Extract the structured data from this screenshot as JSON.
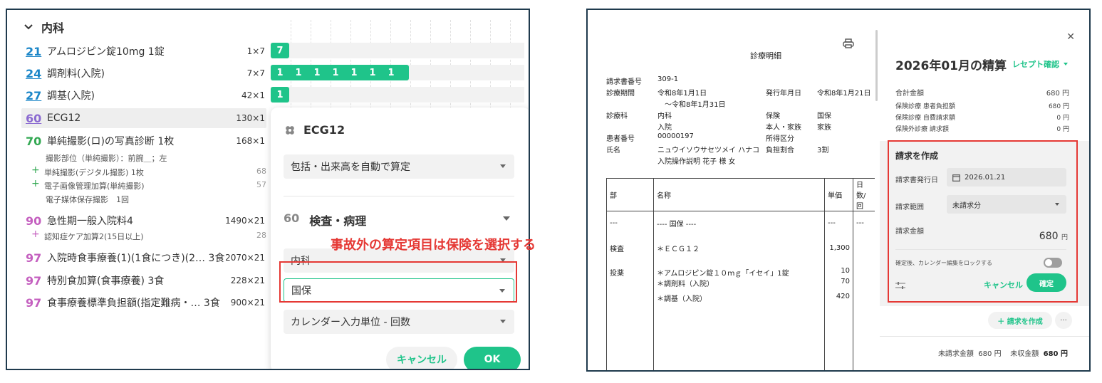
{
  "left": {
    "section_title": "内科",
    "items": [
      {
        "code": "21",
        "name": "アムロジピン錠10mg 1錠",
        "qty": "1×7",
        "style": "blue"
      },
      {
        "code": "24",
        "name": "調剤料(入院)",
        "qty": "7×7",
        "style": "blue"
      },
      {
        "code": "27",
        "name": "調基(入院)",
        "qty": "42×1",
        "style": "blue"
      },
      {
        "code": "60",
        "name": "ECG12",
        "qty": "130×1",
        "style": "purple"
      },
      {
        "code": "70",
        "name": "単純撮影(ロ)の写真診断 1枚",
        "qty": "168×1",
        "style": "green"
      },
      {
        "code": "90",
        "name": "急性期一般入院料4",
        "qty": "1490×21",
        "style": "pink"
      },
      {
        "code": "97",
        "name": "入院時食事療養(1)(1食につき)(2… 3食",
        "qty": "2070×21",
        "style": "pink"
      },
      {
        "code": "97",
        "name": "特別食加算(食事療養) 3食",
        "qty": "228×21",
        "style": "pink"
      },
      {
        "code": "97",
        "name": "食事療養標準負担額(指定難病・… 3食",
        "qty": "900×21",
        "style": "pink"
      }
    ],
    "sub70_detail": "撮影部位（単純撮影）：前腕＿；左",
    "sub70": [
      {
        "name": "単純撮影(デジタル撮影) 1枚",
        "num": "68"
      },
      {
        "name": "電子画像管理加算(単純撮影)",
        "num": "57"
      }
    ],
    "sub70_extra": "電子媒体保存撮影　1回",
    "sub90": {
      "name": "認知症ケア加算2(15日以上)",
      "num": "28"
    },
    "bars": [
      {
        "counts": [
          "7"
        ]
      },
      {
        "counts": [
          "1",
          "1",
          "1",
          "1",
          "1",
          "1",
          "1"
        ]
      },
      {
        "counts": [
          "1"
        ]
      }
    ]
  },
  "popup": {
    "title": "ECG12",
    "auto_select": "包括・出来高を自動で算定",
    "category_num": "60",
    "category_name": "検査・病理",
    "dept_select": "内科",
    "insurance_select": "国保",
    "unit_select": "カレンダー入力単位 - 回数",
    "cancel": "キャンセル",
    "ok": "OK"
  },
  "annotation": "事故外の算定項目は保険を選択する",
  "doc": {
    "title": "診療明細",
    "labels": [
      "請求書番号",
      "診療期間",
      "",
      "診療科",
      "",
      "患者番号",
      "氏名"
    ],
    "values": [
      "309-1",
      "令和8年1月1日",
      "　〜令和8年1月31日",
      "内科",
      "入院",
      "00000197",
      "ニュウイソウサセツメイ ハナコ",
      "入院操作説明 花子 様 女"
    ],
    "labels2": [
      "発行年月日",
      "保険",
      "本人・家族",
      "所得区分",
      "負担割合"
    ],
    "values2": [
      "令和8年1月21日",
      "国保",
      "家族",
      "",
      "3割"
    ],
    "table_headers": [
      "部",
      "名称",
      "単価",
      "日数/回"
    ],
    "table_rows": [
      [
        "---",
        "---- 国保 ----",
        "---",
        "---"
      ],
      [
        "検査",
        "＊ＥＣＧ１２",
        "1,300",
        ""
      ],
      [
        "投薬",
        "＊アムロジピン錠１０ｍｇ「イセイ」1錠",
        "10",
        ""
      ],
      [
        "",
        "＊調剤料（入院）",
        "70",
        ""
      ],
      [
        "",
        "＊調基（入院）",
        "420",
        ""
      ]
    ]
  },
  "settle": {
    "title": "2026年01月の精算",
    "receipt_link": "レセプト確認",
    "total_label": "合計金額",
    "total_value": "680 円",
    "rows": [
      {
        "label": "保険診療 患者負担額",
        "value": "680 円"
      },
      {
        "label": "保険診療 自費請求額",
        "value": "0 円"
      },
      {
        "label": "保険外診療 請求額",
        "value": "0 円"
      }
    ],
    "form_title": "請求を作成",
    "date_label": "請求書発行日",
    "date_value": "2026.01.21",
    "range_label": "請求範囲",
    "range_value": "未請求分",
    "amount_label": "請求金額",
    "amount_value": "680",
    "amount_unit": "円",
    "lock_label": "確定後、カレンダー編集をロックする",
    "cancel": "キャンセル",
    "confirm": "確定",
    "create_button": "＋ 請求を作成",
    "more": "···",
    "unbilled_label": "未請求金額",
    "unbilled_value": "680 円",
    "uncollected_label": "未収金額",
    "uncollected_value": "680 円"
  },
  "colors": {
    "accent": "#1fc48a",
    "annotation": "#e53935",
    "frame": "#1f3a4d"
  }
}
